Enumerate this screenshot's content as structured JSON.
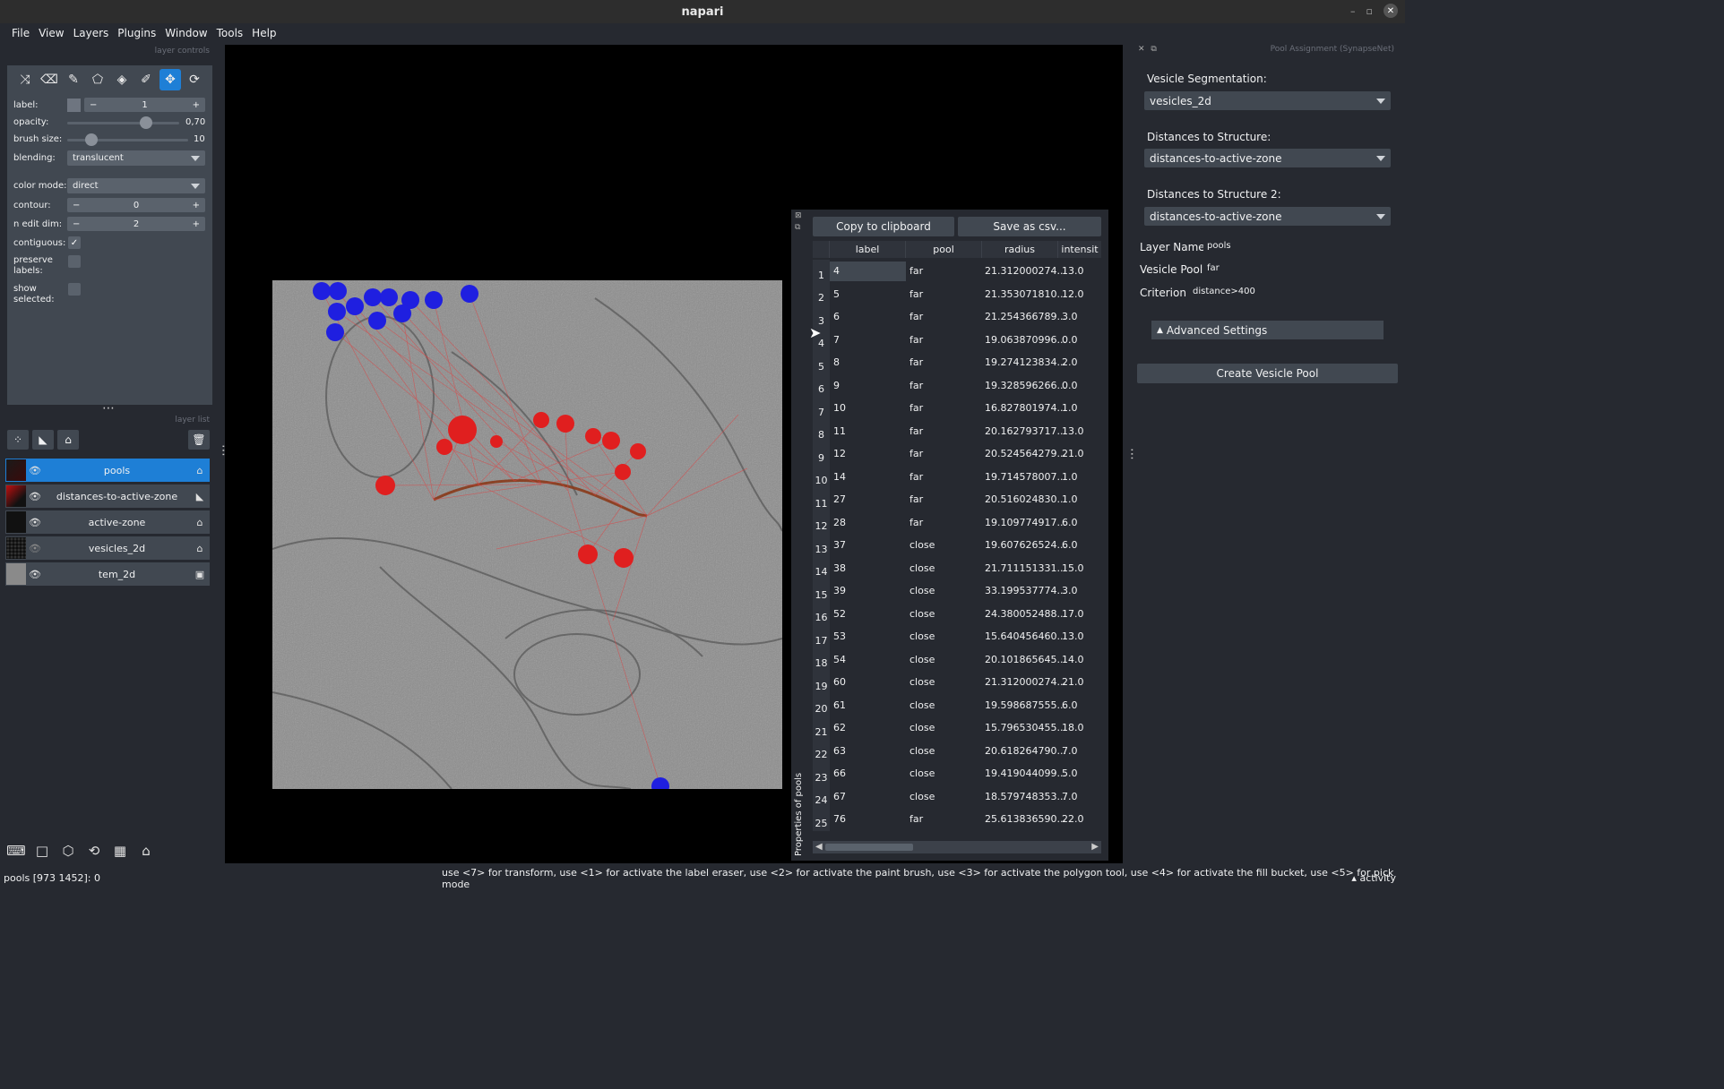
{
  "app": {
    "title": "napari"
  },
  "menu": [
    "File",
    "View",
    "Layers",
    "Plugins",
    "Window",
    "Tools",
    "Help"
  ],
  "layer_controls": {
    "header": "layer controls",
    "label": {
      "name": "label:",
      "value": "1"
    },
    "opacity": {
      "name": "opacity:",
      "value": "0,70",
      "fraction": 0.7
    },
    "brush_size": {
      "name": "brush size:",
      "value": "10",
      "fraction": 0.2
    },
    "blending": {
      "name": "blending:",
      "value": "translucent"
    },
    "color_mode": {
      "name": "color mode:",
      "value": "direct"
    },
    "contour": {
      "name": "contour:",
      "value": "0"
    },
    "n_edit_dim": {
      "name": "n edit dim:",
      "value": "2"
    },
    "contiguous": {
      "name": "contiguous:",
      "checked": true
    },
    "preserve_labels": {
      "name": "preserve\nlabels:",
      "checked": false
    },
    "show_selected": {
      "name": "show\nselected:",
      "checked": false
    }
  },
  "layer_list": {
    "header": "layer list",
    "layers": [
      {
        "name": "pools",
        "selected": true,
        "type_icon": "labels-icon"
      },
      {
        "name": "distances-to-active-zone",
        "selected": false,
        "type_icon": "shapes-icon"
      },
      {
        "name": "active-zone",
        "selected": false,
        "type_icon": "labels-icon"
      },
      {
        "name": "vesicles_2d",
        "selected": false,
        "type_icon": "labels-icon"
      },
      {
        "name": "tem_2d",
        "selected": false,
        "type_icon": "image-icon"
      }
    ]
  },
  "status": {
    "left": "pools [973 1452]: 0",
    "hint": "use <7> for transform, use <1> for activate the label eraser, use <2> for activate the paint brush, use <3> for activate the polygon tool, use <4> for activate the fill bucket, use <5> for pick mode",
    "activity": "activity"
  },
  "table_widget": {
    "copy_label": "Copy to clipboard",
    "save_label": "Save as csv...",
    "side_label": "Properties of pools",
    "columns": [
      "label",
      "pool",
      "radius",
      "intensit"
    ],
    "rows": [
      [
        "1",
        "4",
        "far",
        "21.312000274...",
        "13.0"
      ],
      [
        "2",
        "5",
        "far",
        "21.353071810...",
        "12.0"
      ],
      [
        "3",
        "6",
        "far",
        "21.254366789...",
        "3.0"
      ],
      [
        "4",
        "7",
        "far",
        "19.063870996...",
        "0.0"
      ],
      [
        "5",
        "8",
        "far",
        "19.274123834...",
        "2.0"
      ],
      [
        "6",
        "9",
        "far",
        "19.328596266...",
        "0.0"
      ],
      [
        "7",
        "10",
        "far",
        "16.827801974...",
        "1.0"
      ],
      [
        "8",
        "11",
        "far",
        "20.162793717...",
        "13.0"
      ],
      [
        "9",
        "12",
        "far",
        "20.524564279...",
        "21.0"
      ],
      [
        "10",
        "14",
        "far",
        "19.714578007...",
        "1.0"
      ],
      [
        "11",
        "27",
        "far",
        "20.516024830...",
        "1.0"
      ],
      [
        "12",
        "28",
        "far",
        "19.109774917...",
        "6.0"
      ],
      [
        "13",
        "37",
        "close",
        "19.607626524...",
        "6.0"
      ],
      [
        "14",
        "38",
        "close",
        "21.711151331...",
        "15.0"
      ],
      [
        "15",
        "39",
        "close",
        "33.199537774...",
        "3.0"
      ],
      [
        "16",
        "52",
        "close",
        "24.380052488...",
        "17.0"
      ],
      [
        "17",
        "53",
        "close",
        "15.640456460...",
        "13.0"
      ],
      [
        "18",
        "54",
        "close",
        "20.101865645...",
        "14.0"
      ],
      [
        "19",
        "60",
        "close",
        "21.312000274...",
        "21.0"
      ],
      [
        "20",
        "61",
        "close",
        "19.598687555...",
        "6.0"
      ],
      [
        "21",
        "62",
        "close",
        "15.796530455...",
        "18.0"
      ],
      [
        "22",
        "63",
        "close",
        "20.618264790...",
        "7.0"
      ],
      [
        "23",
        "66",
        "close",
        "19.419044099...",
        "5.0"
      ],
      [
        "24",
        "67",
        "close",
        "18.579748353...",
        "7.0"
      ],
      [
        "25",
        "76",
        "far",
        "25.613836590...",
        "22.0"
      ]
    ]
  },
  "pool_panel": {
    "header": "Pool Assignment (SynapseNet)",
    "vesicle_seg_label": "Vesicle Segmentation:",
    "vesicle_seg_value": "vesicles_2d",
    "dist1_label": "Distances to Structure:",
    "dist1_value": "distances-to-active-zone",
    "dist2_label": "Distances to Structure 2:",
    "dist2_value": "distances-to-active-zone",
    "layer_name_label": "Layer Name",
    "layer_name_value": "pools",
    "vesicle_pool_label": "Vesicle Pool",
    "vesicle_pool_value": "far",
    "criterion_label": "Criterion",
    "criterion_value": "distance>400",
    "advanced_label": "Advanced Settings",
    "create_label": "Create Vesicle Pool"
  },
  "colors": {
    "accent": "#1e7fd6",
    "panel": "#414851",
    "background": "#262930",
    "far_pool": "#1f1fe0",
    "close_pool": "#e01f1f"
  }
}
